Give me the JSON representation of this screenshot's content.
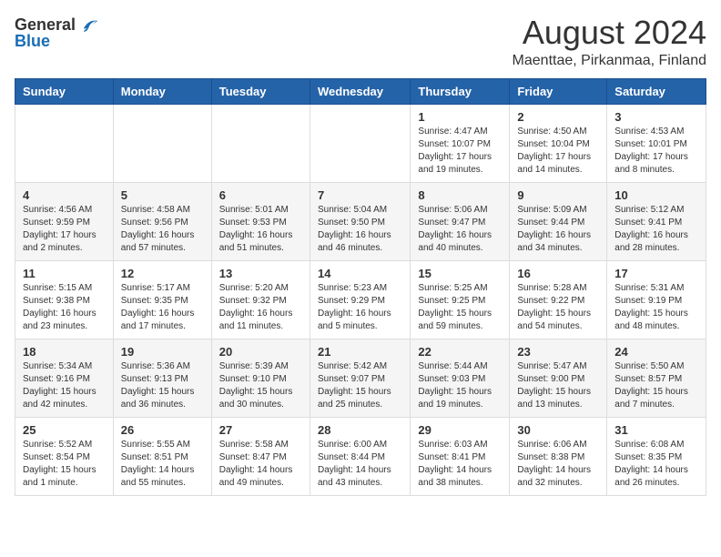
{
  "logo": {
    "general": "General",
    "blue": "Blue"
  },
  "header": {
    "month_year": "August 2024",
    "location": "Maenttae, Pirkanmaa, Finland"
  },
  "weekdays": [
    "Sunday",
    "Monday",
    "Tuesday",
    "Wednesday",
    "Thursday",
    "Friday",
    "Saturday"
  ],
  "weeks": [
    [
      {
        "day": "",
        "info": ""
      },
      {
        "day": "",
        "info": ""
      },
      {
        "day": "",
        "info": ""
      },
      {
        "day": "",
        "info": ""
      },
      {
        "day": "1",
        "info": "Sunrise: 4:47 AM\nSunset: 10:07 PM\nDaylight: 17 hours\nand 19 minutes."
      },
      {
        "day": "2",
        "info": "Sunrise: 4:50 AM\nSunset: 10:04 PM\nDaylight: 17 hours\nand 14 minutes."
      },
      {
        "day": "3",
        "info": "Sunrise: 4:53 AM\nSunset: 10:01 PM\nDaylight: 17 hours\nand 8 minutes."
      }
    ],
    [
      {
        "day": "4",
        "info": "Sunrise: 4:56 AM\nSunset: 9:59 PM\nDaylight: 17 hours\nand 2 minutes."
      },
      {
        "day": "5",
        "info": "Sunrise: 4:58 AM\nSunset: 9:56 PM\nDaylight: 16 hours\nand 57 minutes."
      },
      {
        "day": "6",
        "info": "Sunrise: 5:01 AM\nSunset: 9:53 PM\nDaylight: 16 hours\nand 51 minutes."
      },
      {
        "day": "7",
        "info": "Sunrise: 5:04 AM\nSunset: 9:50 PM\nDaylight: 16 hours\nand 46 minutes."
      },
      {
        "day": "8",
        "info": "Sunrise: 5:06 AM\nSunset: 9:47 PM\nDaylight: 16 hours\nand 40 minutes."
      },
      {
        "day": "9",
        "info": "Sunrise: 5:09 AM\nSunset: 9:44 PM\nDaylight: 16 hours\nand 34 minutes."
      },
      {
        "day": "10",
        "info": "Sunrise: 5:12 AM\nSunset: 9:41 PM\nDaylight: 16 hours\nand 28 minutes."
      }
    ],
    [
      {
        "day": "11",
        "info": "Sunrise: 5:15 AM\nSunset: 9:38 PM\nDaylight: 16 hours\nand 23 minutes."
      },
      {
        "day": "12",
        "info": "Sunrise: 5:17 AM\nSunset: 9:35 PM\nDaylight: 16 hours\nand 17 minutes."
      },
      {
        "day": "13",
        "info": "Sunrise: 5:20 AM\nSunset: 9:32 PM\nDaylight: 16 hours\nand 11 minutes."
      },
      {
        "day": "14",
        "info": "Sunrise: 5:23 AM\nSunset: 9:29 PM\nDaylight: 16 hours\nand 5 minutes."
      },
      {
        "day": "15",
        "info": "Sunrise: 5:25 AM\nSunset: 9:25 PM\nDaylight: 15 hours\nand 59 minutes."
      },
      {
        "day": "16",
        "info": "Sunrise: 5:28 AM\nSunset: 9:22 PM\nDaylight: 15 hours\nand 54 minutes."
      },
      {
        "day": "17",
        "info": "Sunrise: 5:31 AM\nSunset: 9:19 PM\nDaylight: 15 hours\nand 48 minutes."
      }
    ],
    [
      {
        "day": "18",
        "info": "Sunrise: 5:34 AM\nSunset: 9:16 PM\nDaylight: 15 hours\nand 42 minutes."
      },
      {
        "day": "19",
        "info": "Sunrise: 5:36 AM\nSunset: 9:13 PM\nDaylight: 15 hours\nand 36 minutes."
      },
      {
        "day": "20",
        "info": "Sunrise: 5:39 AM\nSunset: 9:10 PM\nDaylight: 15 hours\nand 30 minutes."
      },
      {
        "day": "21",
        "info": "Sunrise: 5:42 AM\nSunset: 9:07 PM\nDaylight: 15 hours\nand 25 minutes."
      },
      {
        "day": "22",
        "info": "Sunrise: 5:44 AM\nSunset: 9:03 PM\nDaylight: 15 hours\nand 19 minutes."
      },
      {
        "day": "23",
        "info": "Sunrise: 5:47 AM\nSunset: 9:00 PM\nDaylight: 15 hours\nand 13 minutes."
      },
      {
        "day": "24",
        "info": "Sunrise: 5:50 AM\nSunset: 8:57 PM\nDaylight: 15 hours\nand 7 minutes."
      }
    ],
    [
      {
        "day": "25",
        "info": "Sunrise: 5:52 AM\nSunset: 8:54 PM\nDaylight: 15 hours\nand 1 minute."
      },
      {
        "day": "26",
        "info": "Sunrise: 5:55 AM\nSunset: 8:51 PM\nDaylight: 14 hours\nand 55 minutes."
      },
      {
        "day": "27",
        "info": "Sunrise: 5:58 AM\nSunset: 8:47 PM\nDaylight: 14 hours\nand 49 minutes."
      },
      {
        "day": "28",
        "info": "Sunrise: 6:00 AM\nSunset: 8:44 PM\nDaylight: 14 hours\nand 43 minutes."
      },
      {
        "day": "29",
        "info": "Sunrise: 6:03 AM\nSunset: 8:41 PM\nDaylight: 14 hours\nand 38 minutes."
      },
      {
        "day": "30",
        "info": "Sunrise: 6:06 AM\nSunset: 8:38 PM\nDaylight: 14 hours\nand 32 minutes."
      },
      {
        "day": "31",
        "info": "Sunrise: 6:08 AM\nSunset: 8:35 PM\nDaylight: 14 hours\nand 26 minutes."
      }
    ]
  ]
}
